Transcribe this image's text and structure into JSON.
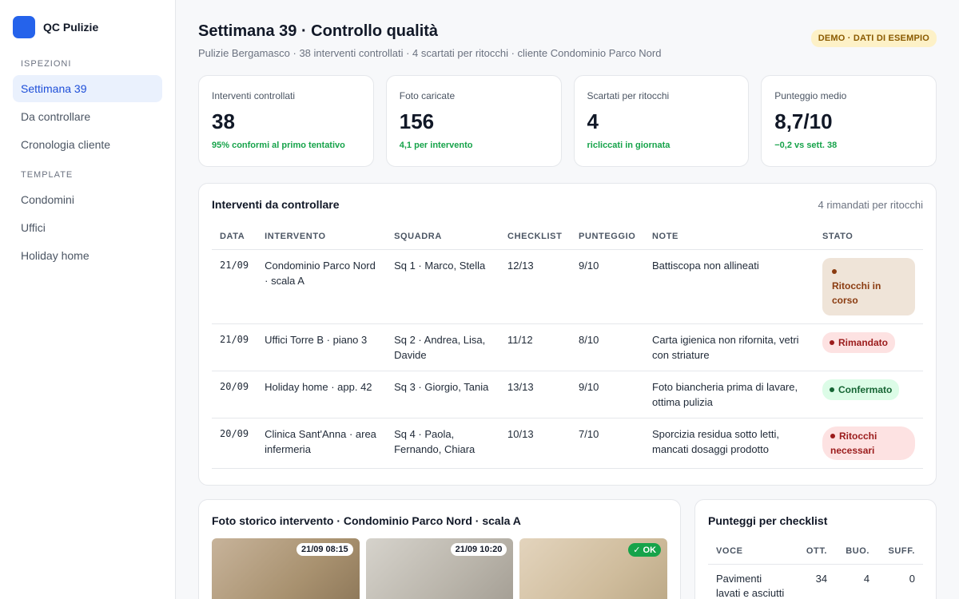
{
  "brand": {
    "name": "QC Pulizie",
    "accent": "#2563eb"
  },
  "sidebar": {
    "sections": [
      {
        "label": "ISPEZIONI",
        "items": [
          {
            "label": "Settimana 39",
            "active": true
          },
          {
            "label": "Da controllare"
          },
          {
            "label": "Cronologia cliente"
          }
        ]
      },
      {
        "label": "TEMPLATE",
        "items": [
          {
            "label": "Condomini"
          },
          {
            "label": "Uffici"
          },
          {
            "label": "Holiday home"
          }
        ]
      }
    ]
  },
  "header": {
    "title": "Settimana 39 · Controllo qualità",
    "subtitle": "Pulizie Bergamasco · 38 interventi controllati · 4 scartati per ritocchi · cliente Condominio Parco Nord",
    "badge": "DEMO · DATI DI ESEMPIO"
  },
  "kpis": [
    {
      "label": "Interventi controllati",
      "value": "38",
      "note": "95% conformi al primo tentativo"
    },
    {
      "label": "Foto caricate",
      "value": "156",
      "note": "4,1 per intervento"
    },
    {
      "label": "Scartati per ritocchi",
      "value": "4",
      "note": "ricliccati in giornata"
    },
    {
      "label": "Punteggio medio",
      "value": "8,7/10",
      "note": "−0,2 vs sett. 38"
    }
  ],
  "interventions": {
    "title": "Interventi da controllare",
    "meta": "4 rimandati per ritocchi",
    "columns": [
      "DATA",
      "INTERVENTO",
      "SQUADRA",
      "CHECKLIST",
      "PUNTEGGIO",
      "NOTE",
      "STATO"
    ],
    "rows": [
      {
        "date": "21/09",
        "intervention": "Condominio Parco Nord · scala A",
        "team": "Sq 1 · Marco, Stella",
        "checklist": "12/13",
        "score": "9/10",
        "note": "Battiscopa non allineati",
        "status": "Ritocchi in corso"
      },
      {
        "date": "21/09",
        "intervention": "Uffici Torre B · piano 3",
        "team": "Sq 2 · Andrea, Lisa, Davide",
        "checklist": "11/12",
        "score": "8/10",
        "note": "Carta igienica non rifornita, vetri con striature",
        "status": "Rimandato"
      },
      {
        "date": "20/09",
        "intervention": "Holiday home · app. 42",
        "team": "Sq 3 · Giorgio, Tania",
        "checklist": "13/13",
        "score": "9/10",
        "note": "Foto biancheria prima di lavare, ottima pulizia",
        "status": "Confermato"
      },
      {
        "date": "20/09",
        "intervention": "Clinica Sant'Anna · area infermeria",
        "team": "Sq 4 · Paola, Fernando, Chiara",
        "checklist": "10/13",
        "score": "7/10",
        "note": "Sporcizia residua sotto letti, mancati dosaggi prodotto",
        "status": "Ritocchi necessari"
      }
    ]
  },
  "photos": {
    "title": "Foto storico intervento · Condominio Parco Nord · scala A",
    "items": [
      {
        "tag": "21/09 08:15"
      },
      {
        "tag": "21/09 10:20"
      },
      {
        "tag": "✓ OK"
      }
    ]
  },
  "scores": {
    "title": "Punteggi per checklist",
    "columns": [
      "VOCE",
      "OTT.",
      "BUO.",
      "SUFF."
    ],
    "rows": [
      {
        "item": "Pavimenti lavati e asciutti",
        "ott": "34",
        "buo": "4",
        "suff": "0"
      }
    ]
  }
}
